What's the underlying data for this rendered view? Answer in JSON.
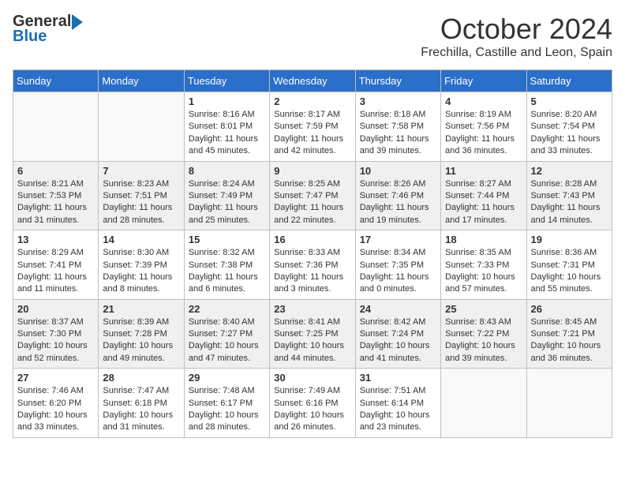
{
  "header": {
    "logo_general": "General",
    "logo_blue": "Blue",
    "month": "October 2024",
    "location": "Frechilla, Castille and Leon, Spain"
  },
  "days_of_week": [
    "Sunday",
    "Monday",
    "Tuesday",
    "Wednesday",
    "Thursday",
    "Friday",
    "Saturday"
  ],
  "weeks": [
    [
      {
        "day": "",
        "info": ""
      },
      {
        "day": "",
        "info": ""
      },
      {
        "day": "1",
        "info": "Sunrise: 8:16 AM\nSunset: 8:01 PM\nDaylight: 11 hours and 45 minutes."
      },
      {
        "day": "2",
        "info": "Sunrise: 8:17 AM\nSunset: 7:59 PM\nDaylight: 11 hours and 42 minutes."
      },
      {
        "day": "3",
        "info": "Sunrise: 8:18 AM\nSunset: 7:58 PM\nDaylight: 11 hours and 39 minutes."
      },
      {
        "day": "4",
        "info": "Sunrise: 8:19 AM\nSunset: 7:56 PM\nDaylight: 11 hours and 36 minutes."
      },
      {
        "day": "5",
        "info": "Sunrise: 8:20 AM\nSunset: 7:54 PM\nDaylight: 11 hours and 33 minutes."
      }
    ],
    [
      {
        "day": "6",
        "info": "Sunrise: 8:21 AM\nSunset: 7:53 PM\nDaylight: 11 hours and 31 minutes."
      },
      {
        "day": "7",
        "info": "Sunrise: 8:23 AM\nSunset: 7:51 PM\nDaylight: 11 hours and 28 minutes."
      },
      {
        "day": "8",
        "info": "Sunrise: 8:24 AM\nSunset: 7:49 PM\nDaylight: 11 hours and 25 minutes."
      },
      {
        "day": "9",
        "info": "Sunrise: 8:25 AM\nSunset: 7:47 PM\nDaylight: 11 hours and 22 minutes."
      },
      {
        "day": "10",
        "info": "Sunrise: 8:26 AM\nSunset: 7:46 PM\nDaylight: 11 hours and 19 minutes."
      },
      {
        "day": "11",
        "info": "Sunrise: 8:27 AM\nSunset: 7:44 PM\nDaylight: 11 hours and 17 minutes."
      },
      {
        "day": "12",
        "info": "Sunrise: 8:28 AM\nSunset: 7:43 PM\nDaylight: 11 hours and 14 minutes."
      }
    ],
    [
      {
        "day": "13",
        "info": "Sunrise: 8:29 AM\nSunset: 7:41 PM\nDaylight: 11 hours and 11 minutes."
      },
      {
        "day": "14",
        "info": "Sunrise: 8:30 AM\nSunset: 7:39 PM\nDaylight: 11 hours and 8 minutes."
      },
      {
        "day": "15",
        "info": "Sunrise: 8:32 AM\nSunset: 7:38 PM\nDaylight: 11 hours and 6 minutes."
      },
      {
        "day": "16",
        "info": "Sunrise: 8:33 AM\nSunset: 7:36 PM\nDaylight: 11 hours and 3 minutes."
      },
      {
        "day": "17",
        "info": "Sunrise: 8:34 AM\nSunset: 7:35 PM\nDaylight: 11 hours and 0 minutes."
      },
      {
        "day": "18",
        "info": "Sunrise: 8:35 AM\nSunset: 7:33 PM\nDaylight: 10 hours and 57 minutes."
      },
      {
        "day": "19",
        "info": "Sunrise: 8:36 AM\nSunset: 7:31 PM\nDaylight: 10 hours and 55 minutes."
      }
    ],
    [
      {
        "day": "20",
        "info": "Sunrise: 8:37 AM\nSunset: 7:30 PM\nDaylight: 10 hours and 52 minutes."
      },
      {
        "day": "21",
        "info": "Sunrise: 8:39 AM\nSunset: 7:28 PM\nDaylight: 10 hours and 49 minutes."
      },
      {
        "day": "22",
        "info": "Sunrise: 8:40 AM\nSunset: 7:27 PM\nDaylight: 10 hours and 47 minutes."
      },
      {
        "day": "23",
        "info": "Sunrise: 8:41 AM\nSunset: 7:25 PM\nDaylight: 10 hours and 44 minutes."
      },
      {
        "day": "24",
        "info": "Sunrise: 8:42 AM\nSunset: 7:24 PM\nDaylight: 10 hours and 41 minutes."
      },
      {
        "day": "25",
        "info": "Sunrise: 8:43 AM\nSunset: 7:22 PM\nDaylight: 10 hours and 39 minutes."
      },
      {
        "day": "26",
        "info": "Sunrise: 8:45 AM\nSunset: 7:21 PM\nDaylight: 10 hours and 36 minutes."
      }
    ],
    [
      {
        "day": "27",
        "info": "Sunrise: 7:46 AM\nSunset: 6:20 PM\nDaylight: 10 hours and 33 minutes."
      },
      {
        "day": "28",
        "info": "Sunrise: 7:47 AM\nSunset: 6:18 PM\nDaylight: 10 hours and 31 minutes."
      },
      {
        "day": "29",
        "info": "Sunrise: 7:48 AM\nSunset: 6:17 PM\nDaylight: 10 hours and 28 minutes."
      },
      {
        "day": "30",
        "info": "Sunrise: 7:49 AM\nSunset: 6:16 PM\nDaylight: 10 hours and 26 minutes."
      },
      {
        "day": "31",
        "info": "Sunrise: 7:51 AM\nSunset: 6:14 PM\nDaylight: 10 hours and 23 minutes."
      },
      {
        "day": "",
        "info": ""
      },
      {
        "day": "",
        "info": ""
      }
    ]
  ]
}
